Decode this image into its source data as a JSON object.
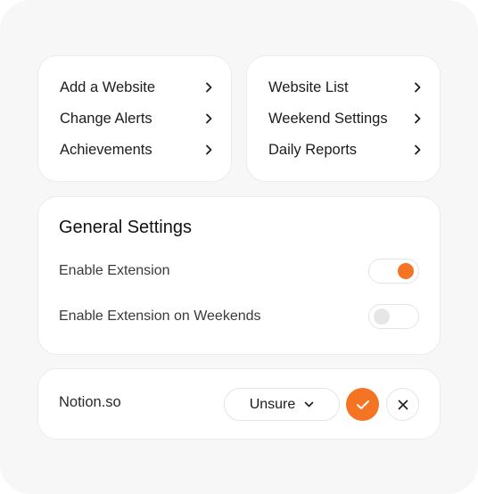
{
  "nav": {
    "left": [
      {
        "label": "Add a Website",
        "icon": "chevron-right-icon"
      },
      {
        "label": "Change Alerts",
        "icon": "chevron-right-icon"
      },
      {
        "label": "Achievements",
        "icon": "chevron-right-icon"
      }
    ],
    "right": [
      {
        "label": "Website List",
        "icon": "chevron-right-icon"
      },
      {
        "label": "Weekend Settings",
        "icon": "chevron-right-icon"
      },
      {
        "label": "Daily Reports",
        "icon": "chevron-right-icon"
      }
    ]
  },
  "general_settings": {
    "title": "General Settings",
    "enable_extension": {
      "label": "Enable Extension",
      "enabled": true
    },
    "enable_weekends": {
      "label": "Enable Extension on Weekends",
      "enabled": false
    }
  },
  "site": {
    "name": "Notion.so",
    "status_selected": "Unsure",
    "confirm_icon": "check-icon",
    "dismiss_icon": "close-icon"
  },
  "colors": {
    "accent": "#f57423",
    "panel_background": "#f7f7f7",
    "card_background": "#ffffff",
    "border": "#ececec",
    "toggle_off_knob": "#e6e6e6"
  }
}
